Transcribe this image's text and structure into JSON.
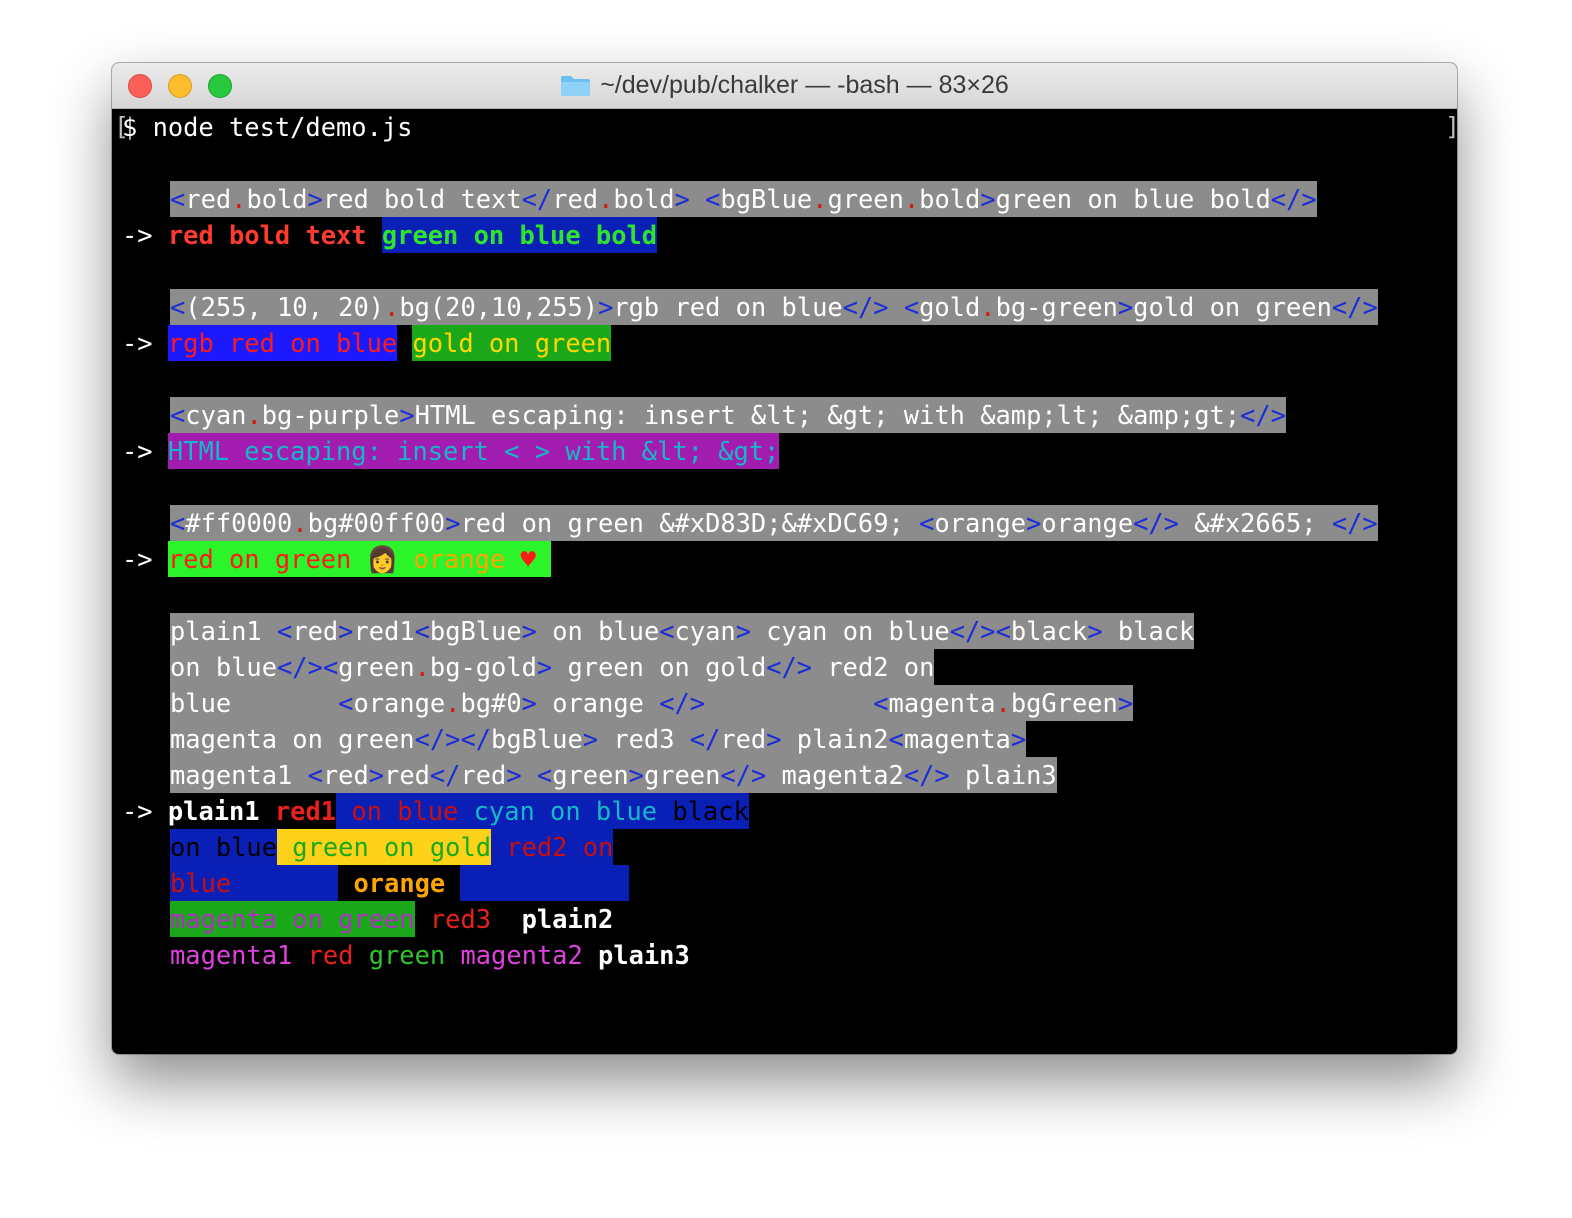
{
  "window": {
    "title": "~/dev/pub/chalker — -bash — 83×26"
  },
  "terminal": {
    "command": "$ node test/demo.js",
    "arrow": "->",
    "prompt": "$",
    "ex1": {
      "src": [
        "<",
        "red",
        ".",
        "bold",
        ">",
        "red bold text",
        "</",
        "red",
        ".",
        "bold",
        ">",
        " ",
        "<",
        "bgBlue",
        ".",
        "green",
        ".",
        "bold",
        ">",
        "green on blue bold",
        "</>"
      ],
      "out": [
        "red bold text",
        " ",
        "green on blue bold"
      ]
    },
    "ex2": {
      "src": [
        "<",
        "(255, 10, 20)",
        ".",
        "bg(20,10,255)",
        ">",
        "rgb red on blue",
        "</>",
        " ",
        "<",
        "gold",
        ".",
        "bg-green",
        ">",
        "gold on green",
        "</>"
      ],
      "out": [
        "rgb red on blue",
        " ",
        "gold on green"
      ]
    },
    "ex3": {
      "src": [
        "<",
        "cyan",
        ".",
        "bg-purple",
        ">",
        "HTML escaping: insert &lt; &gt; with &amp;lt; &amp;gt;",
        "</>"
      ],
      "out": [
        "HTML escaping: insert < > with &lt; &gt;"
      ]
    },
    "ex4": {
      "src": [
        "<",
        "#ff0000",
        ".",
        "bg#00ff00",
        ">",
        "red on green &#xD83D;&#xDC69; ",
        "<",
        "orange",
        ">",
        "orange",
        "</>",
        " &#x2665; ",
        "</>"
      ],
      "out": [
        "red on green ",
        "👩",
        " ",
        "orange",
        " ",
        "♥"
      ]
    },
    "ex5": {
      "src": [
        [
          "plain1 ",
          "<",
          "red",
          ">",
          "red1",
          "<",
          "bgBlue",
          ">",
          " on blue",
          "<",
          "cyan",
          ">",
          " cyan on blue",
          "</>",
          "<",
          "black",
          ">",
          " black"
        ],
        [
          "on blue",
          "</>",
          "<",
          "green",
          ".",
          "bg-gold",
          ">",
          " green on gold",
          "</>",
          " red2 on"
        ],
        [
          "blue       ",
          "<",
          "orange",
          ".",
          "bg#0",
          ">",
          " orange ",
          "</>",
          "           ",
          "<",
          "magenta",
          ".",
          "bgGreen",
          ">"
        ],
        [
          "magenta on green",
          "</>",
          "</",
          "bgBlue",
          ">",
          " red3 ",
          "</",
          "red",
          ">",
          " plain2",
          "<",
          "magenta",
          ">"
        ],
        [
          "magenta1 ",
          "<",
          "red",
          ">",
          "red",
          "</",
          "red",
          ">",
          " ",
          "<",
          "green",
          ">",
          "green",
          "</>",
          " magenta2",
          "</>",
          " plain3"
        ]
      ],
      "out": [
        [
          "plain1 ",
          "red1",
          " on blue",
          " cyan on blue",
          " black"
        ],
        [
          "on blue",
          " green on gold",
          " red2 on"
        ],
        [
          "blue",
          "       ",
          " orange ",
          "           "
        ],
        [
          "magenta on green",
          " red3 ",
          " plain2"
        ],
        [
          "magenta1 ",
          "red",
          " ",
          "green",
          " magenta2",
          " plain3"
        ]
      ]
    }
  }
}
